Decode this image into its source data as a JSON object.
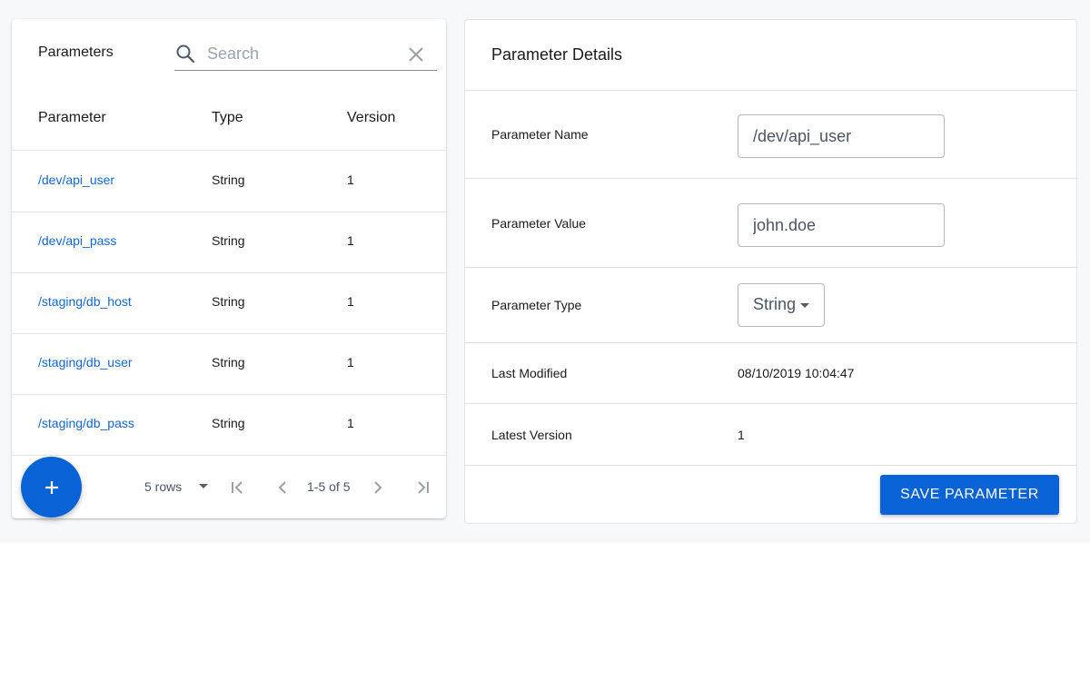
{
  "left": {
    "title": "Parameters",
    "search": {
      "placeholder": "Search",
      "value": ""
    },
    "columns": [
      "Parameter",
      "Type",
      "Version"
    ],
    "rows": [
      {
        "name": "/dev/api_user",
        "type": "String",
        "version": "1"
      },
      {
        "name": "/dev/api_pass",
        "type": "String",
        "version": "1"
      },
      {
        "name": "/staging/db_host",
        "type": "String",
        "version": "1"
      },
      {
        "name": "/staging/db_user",
        "type": "String",
        "version": "1"
      },
      {
        "name": "/staging/db_pass",
        "type": "String",
        "version": "1"
      }
    ],
    "pagination": {
      "rows_per_page": "5 rows",
      "range": "1-5 of 5"
    },
    "fab_label": "+"
  },
  "details": {
    "title": "Parameter Details",
    "name_label": "Parameter Name",
    "name_value": "/dev/api_user",
    "value_label": "Parameter Value",
    "value_value": "john.doe",
    "type_label": "Parameter Type",
    "type_value": "String",
    "modified_label": "Last Modified",
    "modified_value": "08/10/2019 10:04:47",
    "version_label": "Latest Version",
    "version_value": "1",
    "save_label": "SAVE PARAMETER"
  },
  "colors": {
    "accent": "#0a63d6",
    "link": "#1466d1",
    "background": "#f6f8fa"
  },
  "icons": [
    "search-icon",
    "close-icon",
    "add-icon",
    "first-page-icon",
    "prev-page-icon",
    "next-page-icon",
    "last-page-icon",
    "dropdown-caret-icon"
  ]
}
